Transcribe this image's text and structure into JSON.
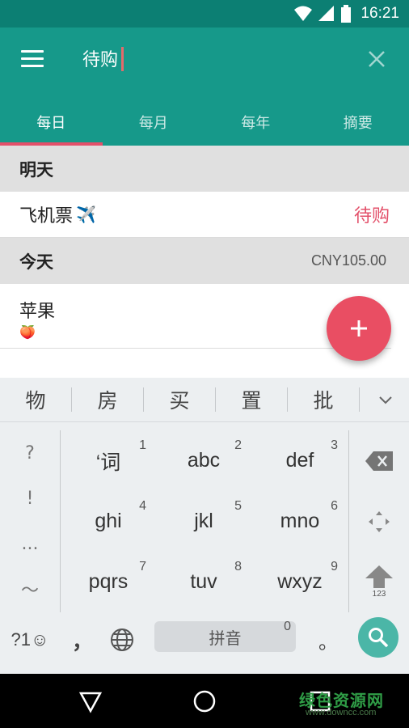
{
  "status_bar": {
    "time": "16:21"
  },
  "toolbar": {
    "search_value": "待购",
    "tabs": [
      "每日",
      "每月",
      "每年",
      "摘要"
    ]
  },
  "list": {
    "sections": [
      {
        "title": "明天",
        "total": "",
        "items": [
          {
            "name": "飞机票",
            "emoji": "✈️",
            "status": "待购"
          }
        ]
      },
      {
        "title": "今天",
        "total": "CNY105.00",
        "items": [
          {
            "name": "苹果",
            "emoji": "🍑",
            "status": ""
          }
        ]
      }
    ]
  },
  "keyboard": {
    "candidates": [
      "物",
      "房",
      "买",
      "置",
      "批"
    ],
    "symbols": [
      "?",
      "!",
      "...",
      "～"
    ],
    "keys": [
      {
        "label": "‘词",
        "num": "1"
      },
      {
        "label": "abc",
        "num": "2"
      },
      {
        "label": "def",
        "num": "3"
      },
      {
        "label": "ghi",
        "num": "4"
      },
      {
        "label": "jkl",
        "num": "5"
      },
      {
        "label": "mno",
        "num": "6"
      },
      {
        "label": "pqrs",
        "num": "7"
      },
      {
        "label": "tuv",
        "num": "8"
      },
      {
        "label": "wxyz",
        "num": "9"
      }
    ],
    "shift_sub": "123",
    "sym_key": "?1☺",
    "comma": "，",
    "space_label": "拼音",
    "space_num": "0",
    "period": "。"
  },
  "watermark": {
    "text": "绿色资源网",
    "url": "www.downcc.com"
  },
  "colors": {
    "primary": "#16998a",
    "status": "#0c7f73",
    "accent": "#e94e63"
  }
}
